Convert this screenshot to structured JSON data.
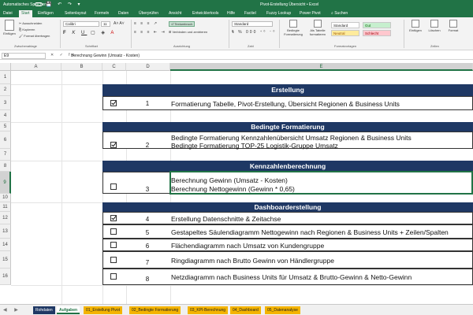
{
  "app": {
    "autosave_label": "Automatisches Speichern",
    "title": "Pivot-Erstellung Übersicht • Excel",
    "search_label": "Suchen"
  },
  "ribbon_tabs": [
    "Datei",
    "Start",
    "Einfügen",
    "Seitenlayout",
    "Formeln",
    "Daten",
    "Überprüfen",
    "Ansicht",
    "Entwicklertools",
    "Hilfe",
    "Factiel",
    "Fuzzy Lookup",
    "Power Pivot"
  ],
  "ribbon": {
    "paste": "Einfügen",
    "cut": "Ausschneiden",
    "copy": "Kopieren",
    "format_painter": "Format übertragen",
    "clipboard_group": "Zwischenablage",
    "font_name": "Calibri",
    "font_size": "11",
    "font_group": "Schriftart",
    "wrap_text": "Textumbruch",
    "merge_center": "Verbinden und zentrieren",
    "alignment_group": "Ausrichtung",
    "number_format": "Standard",
    "number_group": "Zahl",
    "conditional_format": "Bedingte Formatierung",
    "format_as_table": "Als Tabelle formatieren",
    "styles": {
      "standard": "Standard",
      "gut": "Gut",
      "neutral": "Neutral",
      "schlecht": "Schlecht"
    },
    "styles_group": "Formatvorlagen",
    "insert": "Einfügen",
    "delete": "Löschen",
    "format": "Format",
    "cells_group": "Zellen"
  },
  "formula_bar": {
    "cell_ref": "E9",
    "formula": "Berechnung Gewinn (Umsatz - Kosten)"
  },
  "columns": [
    "A",
    "B",
    "C",
    "D",
    "E"
  ],
  "rows": [
    "1",
    "2",
    "3",
    "4",
    "5",
    "6",
    "7",
    "8",
    "9",
    "10",
    "11",
    "12",
    "13",
    "14",
    "15",
    "16"
  ],
  "sections": [
    {
      "title": "Erstellung",
      "items": [
        {
          "checked": true,
          "num": "1",
          "lines": [
            "Formatierung Tabelle, Pivot-Erstellung, Übersicht Regionen & Business Units"
          ]
        }
      ]
    },
    {
      "title": "Bedingte Formatierung",
      "items": [
        {
          "checked": true,
          "num": "2",
          "lines": [
            "Bedingte Formatierung Kennzahlenübersicht Umsatz Regionen & Business Units",
            "Bedingte Formatierung TOP-25 Logistik-Gruppe Umsatz"
          ]
        }
      ]
    },
    {
      "title": "Kennzahlenberechnung",
      "items": [
        {
          "checked": false,
          "num": "3",
          "lines": [
            "Berechnung Gewinn (Umsatz - Kosten)",
            "Berechnung Nettogewinn (Gewinn * 0,65)"
          ]
        }
      ]
    },
    {
      "title": "Dashboarderstellung",
      "items": [
        {
          "checked": true,
          "num": "4",
          "lines": [
            "Erstellung Datenschnitte & Zeitachse"
          ]
        },
        {
          "checked": false,
          "num": "5",
          "lines": [
            "Gestapeltes Säulendiagramm Nettogewinn nach Regionen & Business Units + Zeilen/Spalten"
          ]
        },
        {
          "checked": false,
          "num": "6",
          "lines": [
            "Flächendiagramm nach Umsatz von Kundengruppe"
          ]
        },
        {
          "checked": false,
          "num": "7",
          "lines": [
            "Ringdiagramm nach Brutto Gewinn von Händlergruppe"
          ]
        },
        {
          "checked": false,
          "num": "8",
          "lines": [
            "Netzdiagramm nach Business Units für Umsatz & Brutto-Gewinn & Netto-Gewinn"
          ]
        }
      ]
    }
  ],
  "sheet_tabs": [
    {
      "label": "Rohdaten",
      "color": "#1f3864",
      "text": "#ffffff"
    },
    {
      "label": "Aufgaben",
      "color": "#ffffff",
      "text": "#217346"
    },
    {
      "label": "01_Erstellung Pivot",
      "color": "#f4b400",
      "text": "#222222"
    },
    {
      "label": "02_Bedingte Formatierung",
      "color": "#f4b400",
      "text": "#222222"
    },
    {
      "label": "03_KPI-Berechnung",
      "color": "#f4b400",
      "text": "#222222"
    },
    {
      "label": "04_Dashboard",
      "color": "#f4b400",
      "text": "#222222"
    },
    {
      "label": "05_Datenanalyse",
      "color": "#f4b400",
      "text": "#222222"
    }
  ],
  "colors": {
    "excel_green": "#217346",
    "banner_navy": "#1f3864"
  }
}
